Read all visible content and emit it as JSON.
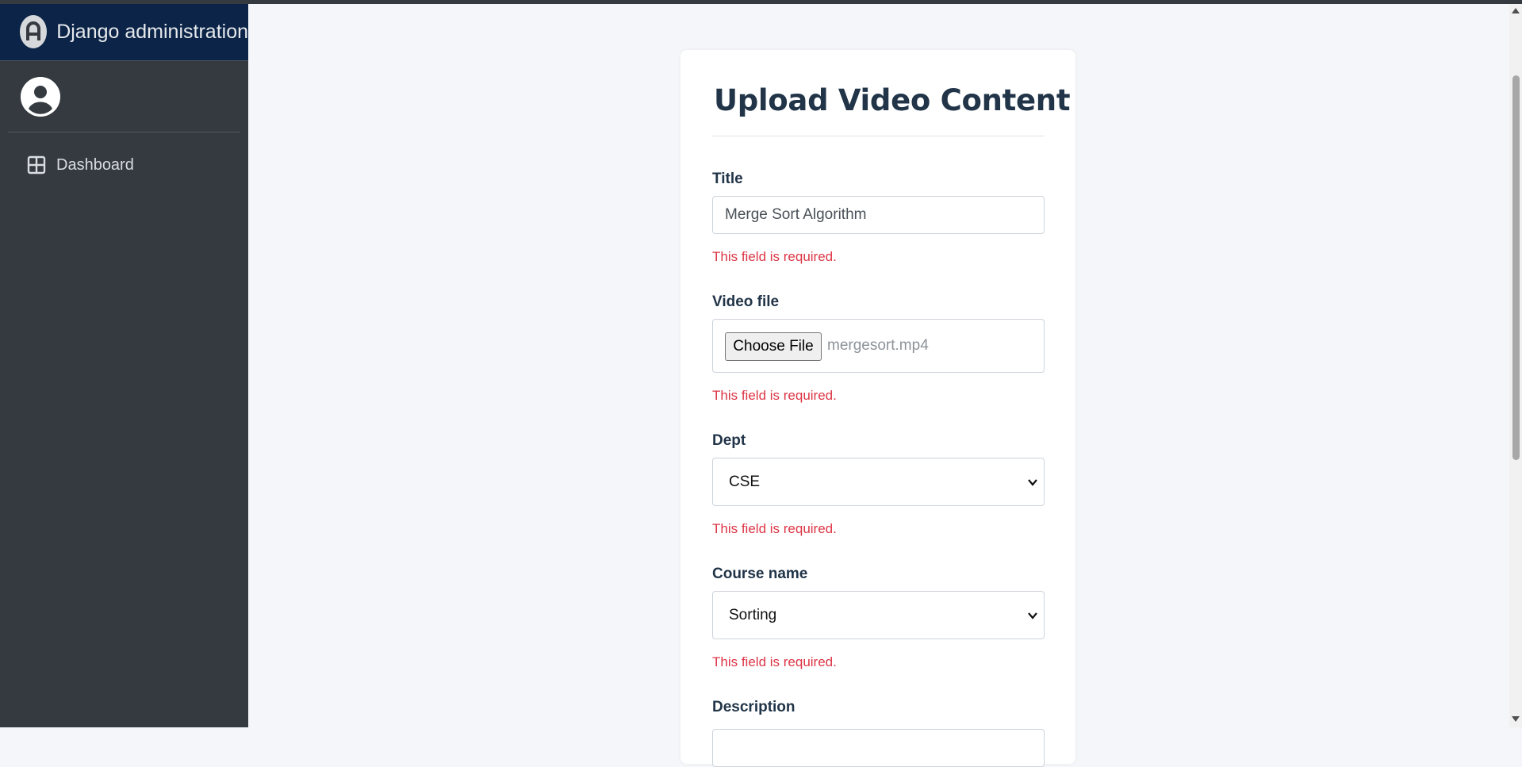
{
  "brand": {
    "title": "Django administration",
    "logo_icon": "admin-logo-icon"
  },
  "user": {
    "avatar_icon": "user-circle-icon"
  },
  "sidebar": {
    "items": [
      {
        "label": "Dashboard",
        "icon": "dashboard-grid-icon"
      }
    ]
  },
  "form": {
    "heading": "Upload Video Content",
    "title": {
      "label": "Title",
      "value": "Merge Sort Algorithm",
      "error": "This field is required."
    },
    "video_file": {
      "label": "Video file",
      "button_label": "Choose File",
      "file_name": "mergesort.mp4",
      "error": "This field is required."
    },
    "dept": {
      "label": "Dept",
      "selected": "CSE",
      "error": "This field is required."
    },
    "course_name": {
      "label": "Course name",
      "selected": "Sorting",
      "error": "This field is required."
    },
    "description": {
      "label": "Description"
    }
  },
  "colors": {
    "sidebar_bg": "#343a40",
    "brand_bg": "#0b2447",
    "error": "#dc3545",
    "heading": "#213448"
  }
}
